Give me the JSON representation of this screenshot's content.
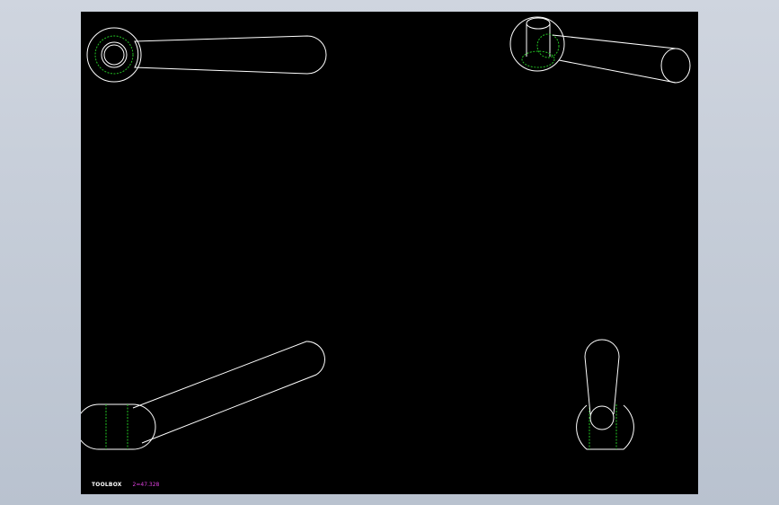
{
  "drawing": {
    "background": "#000000",
    "edge_color": "#ffffff",
    "hidden_line_color": "#22c322",
    "views": [
      {
        "name": "top-view",
        "description": "clamping lever handle, top view"
      },
      {
        "name": "isometric-view",
        "description": "clamping lever handle, isometric view"
      },
      {
        "name": "front-view",
        "description": "clamping lever handle, front view"
      },
      {
        "name": "side-view",
        "description": "clamping lever handle, side view"
      }
    ]
  },
  "footer": {
    "company": "TOOLBOX",
    "scale_text": "2=47.328",
    "scale_color": "#e040e0"
  }
}
